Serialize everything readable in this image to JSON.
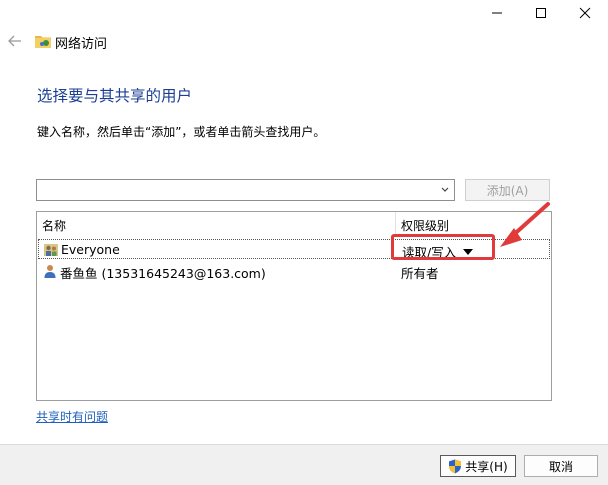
{
  "window": {
    "title": "网络访问",
    "controls": [
      "minimize-icon",
      "maximize-icon",
      "close-icon"
    ]
  },
  "heading": "选择要与其共享的用户",
  "instruction": "键入名称，然后单击“添加”，或者单击箭头查找用户。",
  "name_input": {
    "value": "",
    "placeholder": ""
  },
  "add_button": "添加(A)",
  "list": {
    "columns": [
      "名称",
      "权限级别"
    ],
    "rows": [
      {
        "name": "Everyone",
        "permission": "读取/写入",
        "icon": "group-icon"
      },
      {
        "name": "番鱼鱼 (13531645243@163.com)",
        "permission": "所有者",
        "icon": "user-icon"
      }
    ]
  },
  "help_link": "共享时有问题",
  "buttons": {
    "share": "共享(H)",
    "cancel": "取消"
  },
  "colors": {
    "heading": "#1c3f94",
    "link": "#1f5fbf",
    "annotation": "#e03a3a"
  }
}
